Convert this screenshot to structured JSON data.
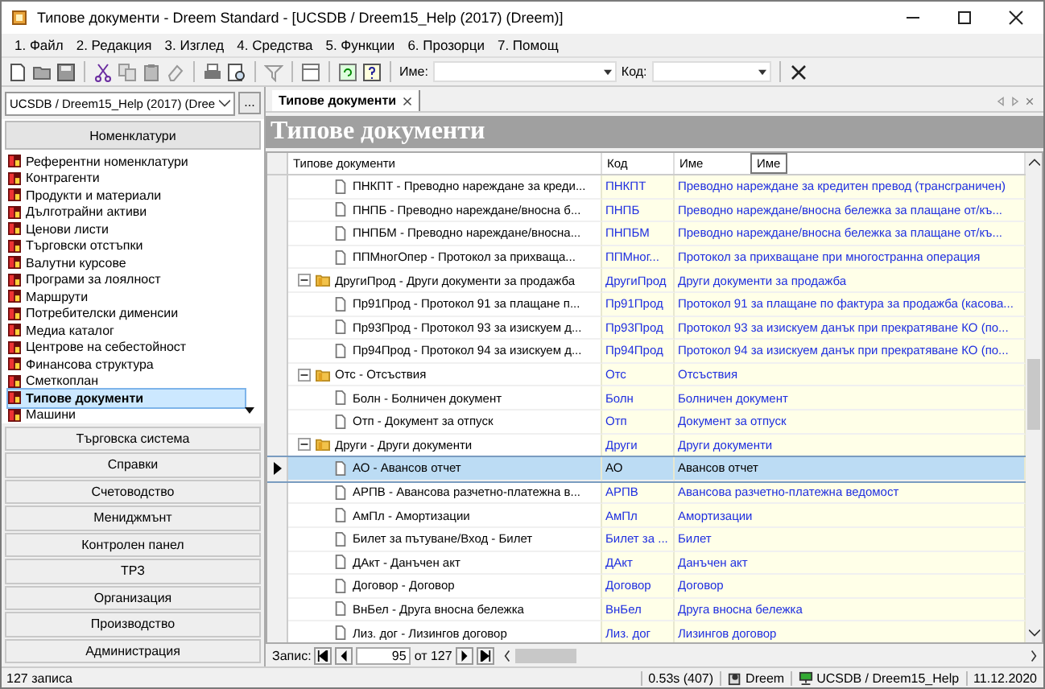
{
  "window": {
    "title": "Типове документи - Dreem Standard - [UCSDB / Dreem15_Help (2017) (Dreem)]"
  },
  "menu": [
    {
      "label": "1. Файл"
    },
    {
      "label": "2. Редакция"
    },
    {
      "label": "3. Изглед"
    },
    {
      "label": "4. Средства"
    },
    {
      "label": "5. Функции"
    },
    {
      "label": "6. Прозорци"
    },
    {
      "label": "7. Помощ"
    }
  ],
  "toolbar": {
    "name_label": "Име:",
    "code_label": "Код:"
  },
  "sidebar": {
    "database": "UCSDB / Dreem15_Help (2017) (Dree",
    "browse": "...",
    "section": "Номенклатури",
    "items": [
      {
        "label": "Референтни номенклатури",
        "selected": false
      },
      {
        "label": "Контрагенти",
        "selected": false
      },
      {
        "label": "Продукти и материали",
        "selected": false
      },
      {
        "label": "Дълготрайни активи",
        "selected": false
      },
      {
        "label": "Ценови листи",
        "selected": false
      },
      {
        "label": "Търговски отстъпки",
        "selected": false
      },
      {
        "label": "Валутни курсове",
        "selected": false
      },
      {
        "label": "Програми за лоялност",
        "selected": false
      },
      {
        "label": "Маршрути",
        "selected": false
      },
      {
        "label": "Потребителски дименсии",
        "selected": false
      },
      {
        "label": "Медиа каталог",
        "selected": false
      },
      {
        "label": "Центрове на себестойност",
        "selected": false
      },
      {
        "label": "Финансова структура",
        "selected": false
      },
      {
        "label": "Сметкоплан",
        "selected": false
      },
      {
        "label": "Типове документи",
        "selected": true
      },
      {
        "label": "Машини",
        "selected": false
      }
    ],
    "sections": [
      "Търговска система",
      "Справки",
      "Счетоводство",
      "Мениджмънт",
      "Контролен панел",
      "ТРЗ",
      "Организация",
      "Производство",
      "Администрация"
    ]
  },
  "content": {
    "tab": {
      "label": "Типове документи",
      "selected": true
    },
    "heading": "Типове документи",
    "columns": [
      "Типове документи",
      "Код",
      "Име"
    ],
    "tooltip": "Име",
    "tree": [
      {
        "kind": "continued",
        "children": [
          {
            "kind": "document",
            "label": "ПНКПТ - Преводно нареждане за креди...",
            "code": "ПНКПТ",
            "name": "Преводно нареждане за кредитен превод (трансграничен)",
            "selected": false
          },
          {
            "kind": "document",
            "label": "ПНПБ - Преводно нареждане/вносна б...",
            "code": "ПНПБ",
            "name": "Преводно нареждане/вносна бележка за плащане от/къ...",
            "selected": false
          },
          {
            "kind": "document",
            "label": "ПНПБМ - Преводно нареждане/вносна...",
            "code": "ПНПБМ",
            "name": "Преводно нареждане/вносна бележка за плащане от/къ...",
            "selected": false
          },
          {
            "kind": "document",
            "label": "ППМногОпер - Протокол за прихваща...",
            "code": "ППМног...",
            "name": "Протокол за прихващане при многостранна операция",
            "selected": false
          }
        ]
      },
      {
        "kind": "folder",
        "label": "ДругиПрод - Други документи за продажба",
        "code": "ДругиПрод",
        "name": "Други документи за продажба",
        "expanded": true,
        "selected": false,
        "children": [
          {
            "kind": "document",
            "label": "Пр91Прод - Протокол 91 за плащане п...",
            "code": "Пр91Прод",
            "name": "Протокол 91 за плащане по фактура за продажба (касова...",
            "selected": false
          },
          {
            "kind": "document",
            "label": "Пр93Прод - Протокол 93 за изискуем д...",
            "code": "Пр93Прод",
            "name": "Протокол 93 за изискуем данък при прекратяване КО (по...",
            "selected": false
          },
          {
            "kind": "document",
            "label": "Пр94Прод - Протокол 94 за изискуем д...",
            "code": "Пр94Прод",
            "name": "Протокол 94 за изискуем данък при прекратяване КО (по...",
            "selected": false
          }
        ]
      },
      {
        "kind": "folder",
        "label": "Отс - Отсъствия",
        "code": "Отс",
        "name": "Отсъствия",
        "expanded": true,
        "selected": false,
        "children": [
          {
            "kind": "document",
            "label": "Болн - Болничен документ",
            "code": "Болн",
            "name": "Болничен документ",
            "selected": false
          },
          {
            "kind": "document",
            "label": "Отп - Документ за отпуск",
            "code": "Отп",
            "name": "Документ за отпуск",
            "selected": false
          }
        ]
      },
      {
        "kind": "folder",
        "label": "Други - Други документи",
        "code": "Други",
        "name": "Други документи",
        "expanded": true,
        "selected": false,
        "children": [
          {
            "kind": "document",
            "label": "АО - Авансов отчет",
            "code": "АО",
            "name": "Авансов отчет",
            "selected": true
          },
          {
            "kind": "document",
            "label": "АРПВ - Авансова разчетно-платежна в...",
            "code": "АРПВ",
            "name": "Авансова разчетно-платежна ведомост",
            "selected": false
          },
          {
            "kind": "document",
            "label": "АмПл - Амортизации",
            "code": "АмПл",
            "name": "Амортизации",
            "selected": false
          },
          {
            "kind": "document",
            "label": "Билет за пътуване/Вход - Билет",
            "code": "Билет за ...",
            "name": "Билет",
            "selected": false
          },
          {
            "kind": "document",
            "label": "ДАкт - Данъчен акт",
            "code": "ДАкт",
            "name": "Данъчен акт",
            "selected": false
          },
          {
            "kind": "document",
            "label": "Договор - Договор",
            "code": "Договор",
            "name": "Договор",
            "selected": false
          },
          {
            "kind": "document",
            "label": "ВнБел - Друга вносна бележка",
            "code": "ВнБел",
            "name": "Друга вносна бележка",
            "selected": false
          },
          {
            "kind": "document",
            "label": "Лиз. дог - Лизингов договор",
            "code": "Лиз. дог",
            "name": "Лизингов договор",
            "selected": false
          }
        ]
      }
    ],
    "navigator": {
      "label": "Запис:",
      "value": "95",
      "total": "от 127"
    }
  },
  "status_bar": {
    "records": "127 записа",
    "timing": "0.53s (407)",
    "user": "Dreem",
    "database": "UCSDB / Dreem15_Help",
    "date": "11.12.2020"
  }
}
